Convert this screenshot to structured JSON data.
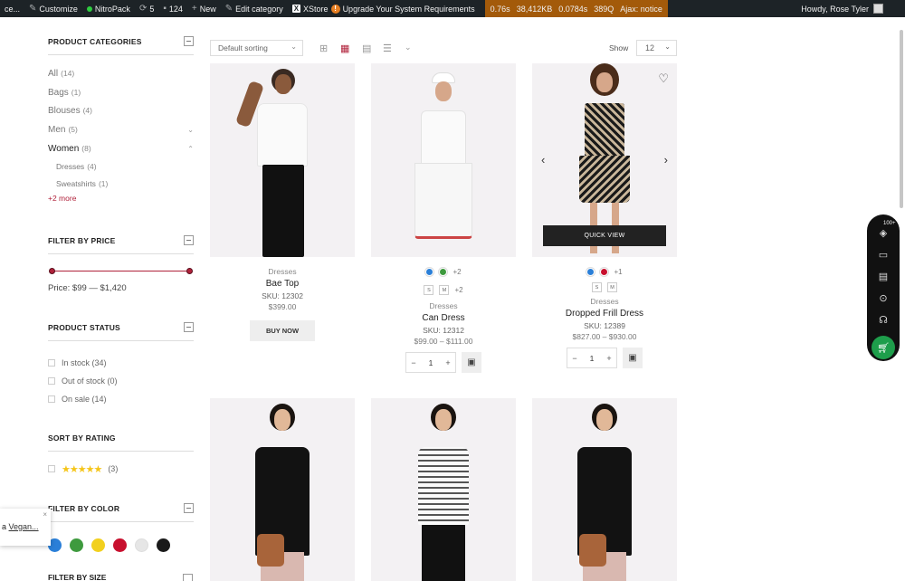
{
  "adminbar": {
    "site": "ce...",
    "customize": "Customize",
    "nitropack": "NitroPack",
    "updates": "5",
    "comments": "124",
    "new": "New",
    "edit_category": "Edit category",
    "xstore": "XStore",
    "upgrade": "Upgrade Your System Requirements",
    "qm_time": "0.76s",
    "qm_mem": "38,412KB",
    "qm_db": "0.0784s",
    "qm_q": "389Q",
    "qm_ajax": "Ajax: notice",
    "howdy": "Howdy, Rose Tyler"
  },
  "sidebar": {
    "categories_title": "PRODUCT CATEGORIES",
    "categories": [
      {
        "name": "All",
        "count": "(14)"
      },
      {
        "name": "Bags",
        "count": "(1)"
      },
      {
        "name": "Blouses",
        "count": "(4)"
      },
      {
        "name": "Men",
        "count": "(5)"
      },
      {
        "name": "Women",
        "count": "(8)"
      }
    ],
    "subcategories": [
      {
        "name": "Dresses",
        "count": "(4)"
      },
      {
        "name": "Sweatshirts",
        "count": "(1)"
      }
    ],
    "more": "+2 more",
    "price_title": "FILTER BY PRICE",
    "price_text": "Price: $99 — $1,420",
    "status_title": "PRODUCT STATUS",
    "status": [
      {
        "label": "In stock",
        "count": "(34)"
      },
      {
        "label": "Out of stock",
        "count": "(0)"
      },
      {
        "label": "On sale",
        "count": "(14)"
      }
    ],
    "rating_title": "SORT BY RATING",
    "rating_stars": "★★★★★",
    "rating_count": "(3)",
    "color_title": "FILTER BY COLOR",
    "colors": [
      "#2a7fd8",
      "#3e9a3e",
      "#f2d01e",
      "#c8102e",
      "#e6e6e6",
      "#1a1a1a"
    ],
    "size_title": "FILTER BY SIZE"
  },
  "toolbar": {
    "sort": "Default sorting",
    "show_label": "Show",
    "show_value": "12"
  },
  "products": [
    {
      "cat": "Dresses",
      "name": "Bae Top",
      "sku": "SKU: 12302",
      "price": "$399.00",
      "button": "BUY NOW"
    },
    {
      "cat": "Dresses",
      "name": "Can Dress",
      "sku": "SKU: 12312",
      "price": "$99.00 – $111.00",
      "colors_more": "+2",
      "sizes": [
        "S",
        "M"
      ],
      "sizes_more": "+2",
      "qty": "1"
    },
    {
      "cat": "Dresses",
      "name": "Dropped Frill Dress",
      "sku": "SKU: 12389",
      "price": "$827.00 – $930.00",
      "colors_more": "+1",
      "sizes": [
        "S",
        "M"
      ],
      "qty": "1",
      "quick_view": "QUICK VIEW"
    }
  ],
  "tool_panel": {
    "badge": "100+"
  },
  "notice": {
    "prefix": "a",
    "link": "Vegan..."
  }
}
